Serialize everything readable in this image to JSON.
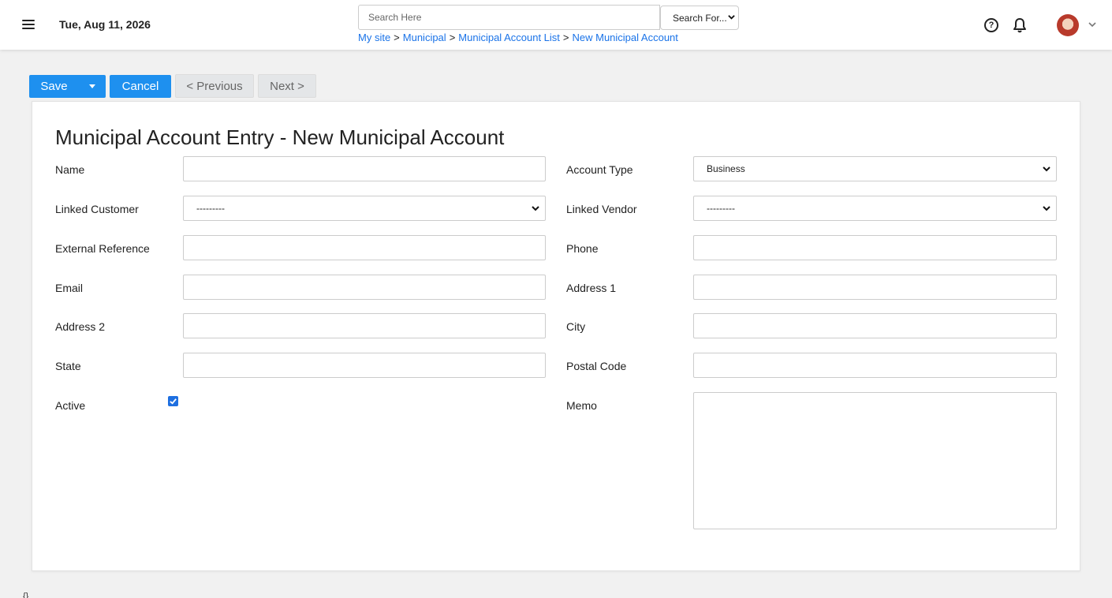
{
  "header": {
    "date": "Tue, Aug 11, 2026",
    "search": {
      "placeholder": "Search Here",
      "select_value": "Search For..."
    },
    "breadcrumb": [
      "My site",
      "Municipal",
      "Municipal Account List",
      "New Municipal Account"
    ],
    "breadcrumb_separator": ">"
  },
  "toolbar": {
    "save_label": "Save",
    "cancel_label": "Cancel",
    "previous_label": "< Previous",
    "next_label": "Next >"
  },
  "form": {
    "title": "Municipal Account Entry - New Municipal Account",
    "labels": {
      "name": "Name",
      "account_type": "Account Type",
      "linked_customer": "Linked Customer",
      "linked_vendor": "Linked Vendor",
      "external_reference": "External Reference",
      "phone": "Phone",
      "email": "Email",
      "address1": "Address 1",
      "address2": "Address 2",
      "city": "City",
      "state": "State",
      "postal_code": "Postal Code",
      "active": "Active",
      "memo": "Memo"
    },
    "values": {
      "account_type": "Business",
      "linked_customer": "---------",
      "linked_vendor": "---------",
      "active": true
    }
  },
  "footer_mark": "{}"
}
